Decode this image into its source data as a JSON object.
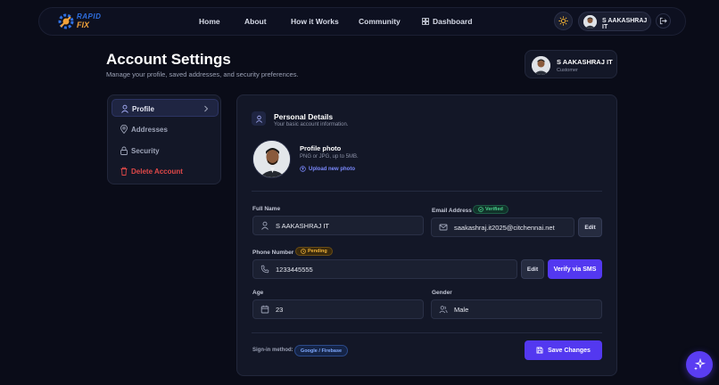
{
  "brand": {
    "line1": "RAPID",
    "line2": "FIX"
  },
  "nav": {
    "links": [
      "Home",
      "About",
      "How it Works",
      "Community",
      "Dashboard"
    ],
    "user_name": "S AAKASHRAJ IT"
  },
  "header": {
    "title": "Account Settings",
    "subtitle": "Manage your profile, saved addresses, and security preferences.",
    "profile_name": "S AAKASHRAJ IT",
    "profile_role": "Customer"
  },
  "sidebar": {
    "items": [
      {
        "label": "Profile",
        "icon": "user-icon",
        "active": true
      },
      {
        "label": "Addresses",
        "icon": "map-pin-icon"
      },
      {
        "label": "Security",
        "icon": "lock-icon"
      },
      {
        "label": "Delete Account",
        "icon": "trash-icon",
        "danger": true
      }
    ]
  },
  "personal": {
    "title": "Personal Details",
    "subtitle": "Your basic account information.",
    "photo_title": "Profile photo",
    "photo_sub": "PNG or JPG, up to 5MB.",
    "upload_label": "Upload new photo"
  },
  "form": {
    "full_name": {
      "label": "Full Name",
      "value": "S AAKASHRAJ IT"
    },
    "email": {
      "label": "Email Address",
      "badge": "Verified",
      "value": "saakashraj.it2025@citchennai.net",
      "edit": "Edit"
    },
    "phone": {
      "label": "Phone Number",
      "badge": "Pending",
      "value": "1233445555",
      "edit": "Edit",
      "verify": "Verify via SMS"
    },
    "age": {
      "label": "Age",
      "value": "23"
    },
    "gender": {
      "label": "Gender",
      "value": "Male"
    }
  },
  "footer": {
    "signin_label": "Sign-in method:",
    "signin_value": "Google / Firebase",
    "save_label": "Save Changes"
  },
  "colors": {
    "background": "#0a0c18",
    "card": "#131727",
    "accent": "#5338f0",
    "danger": "#e04848",
    "verified": "#4ad18c",
    "pending": "#f0b23a"
  }
}
